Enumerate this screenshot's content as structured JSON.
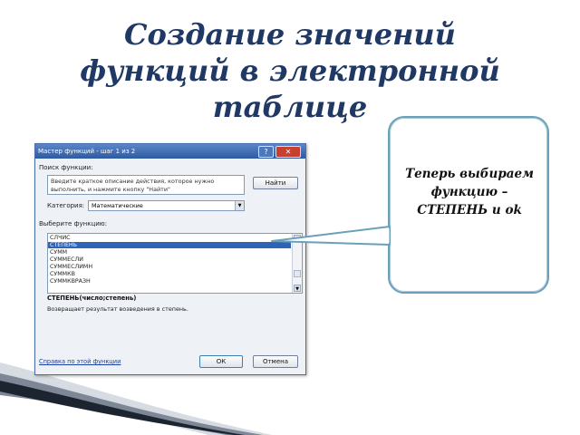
{
  "slide": {
    "title_lines": [
      "Создание значений",
      "функций в электронной",
      "таблице"
    ],
    "callout_text": "Теперь выбираем функцию – СТЕПЕНЬ и ok"
  },
  "dialog": {
    "title": "Мастер функций - шаг 1 из 2",
    "help_button": "?",
    "close_button": "✕",
    "search_label": "Поиск функции:",
    "search_value": "Введите краткое описание действия, которое нужно выполнить, и нажмите кнопку \"Найти\"",
    "find_button": "Найти",
    "category_label": "Категория:",
    "category_value": "Математические",
    "choose_label": "Выберите функцию:",
    "functions": [
      "СЛЧИС",
      "СТЕПЕНЬ",
      "СУММ",
      "СУММЕСЛИ",
      "СУММЕСЛИМН",
      "СУММКВ",
      "СУММКВРАЗН"
    ],
    "selected_index": 1,
    "signature": "СТЕПЕНЬ(число;степень)",
    "description": "Возвращает результат возведения в степень.",
    "help_link": "Справка по этой функции",
    "ok_button": "ОК",
    "cancel_button": "Отмена"
  },
  "colors": {
    "title": "#1f3864",
    "selection": "#2f63b5",
    "callout_border": "#6aa0b8"
  }
}
